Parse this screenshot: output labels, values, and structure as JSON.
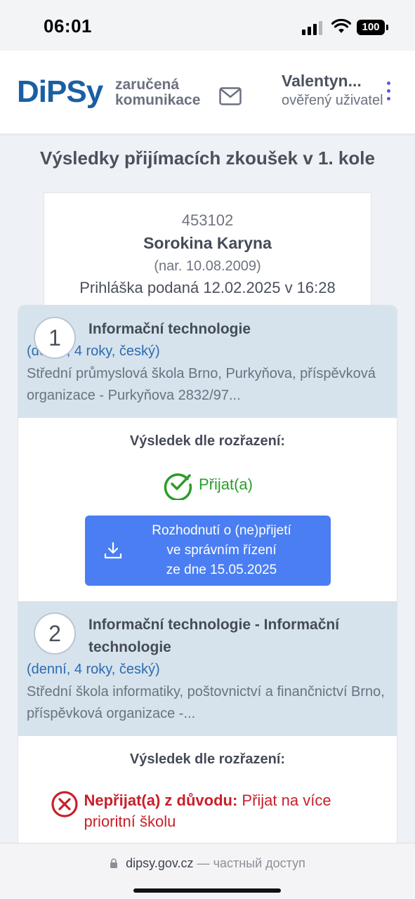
{
  "status_bar": {
    "time": "06:01",
    "battery": "100"
  },
  "header": {
    "logo_text": "DiPSy",
    "tagline_line1": "zaručená",
    "tagline_line2": "komunikace",
    "user_name": "Valentyn...",
    "user_status": "ověřený uživatel"
  },
  "page": {
    "title": "Výsledky přijímacích zkoušek v 1. kole"
  },
  "applicant": {
    "number": "453102",
    "name": "Sorokina Karyna",
    "birth": "(nar. 10.08.2009)",
    "submitted": "Prihláška podaná 12.02.2025 v 16:28"
  },
  "applications": [
    {
      "order": "1",
      "title": "Informační technologie",
      "mode": "(denní, 4 roky, český)",
      "school": "Střední průmyslová škola Brno, Purkyňova, příspěvková organizace - Purkyňova 2832/97...",
      "result_label": "Výsledek dle rozřazení:",
      "status": "Přijat(a)",
      "decision_button": {
        "line1": "Rozhodnutí o (ne)přijetí",
        "line2": "ve správním řízení",
        "line3": "ze dne 15.05.2025"
      }
    },
    {
      "order": "2",
      "title": "Informační technologie - Informační technologie",
      "mode": "(denní, 4 roky, český)",
      "school": "Střední škola informatiky, poštovnictví a finančnictví Brno, příspěvková organizace -...",
      "result_label": "Výsledek dle rozřazení:",
      "status_prefix": "Nepřijat(a) z důvodu:",
      "status_reason": "Přijat na více prioritní školu"
    }
  ],
  "url_bar": {
    "domain": "dipsy.gov.cz",
    "separator": "—",
    "private_label": "частный доступ"
  },
  "colors": {
    "brand": "#1b5fa3",
    "accent_button": "#4a7ef2",
    "success": "#2a9d2a",
    "error": "#c8202a",
    "school_block_bg": "#d6e3ec"
  }
}
